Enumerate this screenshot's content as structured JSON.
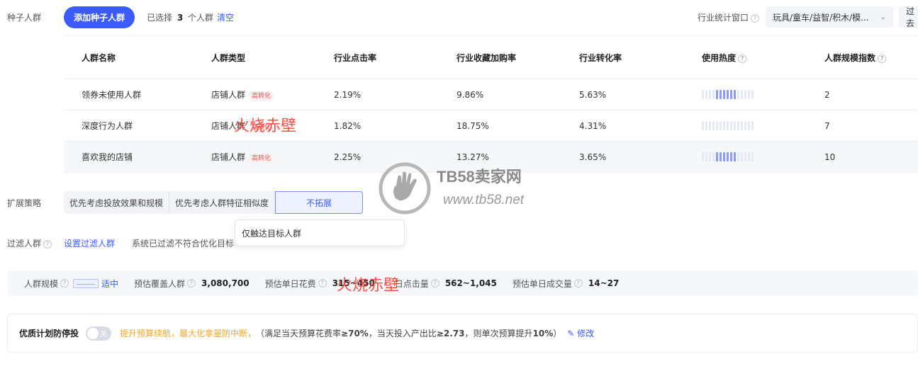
{
  "seed": {
    "label": "种子人群",
    "add_button": "添加种子人群",
    "selected_prefix": "已选择",
    "selected_count": "3",
    "selected_suffix": "个人群",
    "clear": "清空"
  },
  "window": {
    "label": "行业统计窗口",
    "category_value": "玩具/童车/益智/积木/模...",
    "range_value": "过去"
  },
  "table": {
    "headers": [
      "人群名称",
      "人群类型",
      "行业点击率",
      "行业收藏加购率",
      "行业转化率",
      "使用热度",
      "人群规模指数"
    ],
    "rows": [
      {
        "name": "领券未使用人群",
        "type": "店铺人群",
        "tag": "高转化",
        "ctr": "2.19%",
        "fav": "9.86%",
        "cvr": "5.63%",
        "heat": 6,
        "scale": "2"
      },
      {
        "name": "深度行为人群",
        "type": "店铺人群",
        "tag": "高转化",
        "ctr": "1.82%",
        "fav": "18.75%",
        "cvr": "4.31%",
        "heat": 0,
        "scale": "7"
      },
      {
        "name": "喜欢我的店铺",
        "type": "店铺人群",
        "tag": "高转化",
        "ctr": "2.25%",
        "fav": "13.27%",
        "cvr": "3.65%",
        "heat": 6,
        "scale": "10"
      }
    ]
  },
  "strategy": {
    "label": "扩展策略",
    "options": [
      "优先考虑投放效果和规模",
      "优先考虑人群特征相似度",
      "不拓展"
    ],
    "selected": "不拓展",
    "dropdown_text": "仅触达目标人群"
  },
  "filter": {
    "label": "过滤人群",
    "set_link": "设置过滤人群",
    "desc": "系统已过滤不符合优化目标"
  },
  "scale": {
    "label": "人群规模",
    "level": "适中",
    "cover_label": "预估覆盖人群",
    "cover_value": "3,080,700",
    "cost_label": "预估单日花费",
    "cost_value": "315~450",
    "click_label": "日点击量",
    "click_value": "562~1,045",
    "deal_label": "预估单日成交量",
    "deal_value": "14~27"
  },
  "protect": {
    "label": "优质计划防停投",
    "toggle": "关",
    "highlight": "提升预算续航，最大化拿量防中断，",
    "rule_1": "（满足当天预算花费率",
    "rule_1_val": "≥70%",
    "rule_2": "，当天投入产出比",
    "rule_2_val": "≥2.73",
    "rule_3": "，则单次预算提升",
    "rule_3_val": "10%",
    "rule_4": "）",
    "edit": "修改"
  },
  "watermark": {
    "red_1": "火烧赤壁",
    "red_2": "火烧赤壁",
    "site": "TB58卖家网",
    "url": "www.tb58.net"
  }
}
